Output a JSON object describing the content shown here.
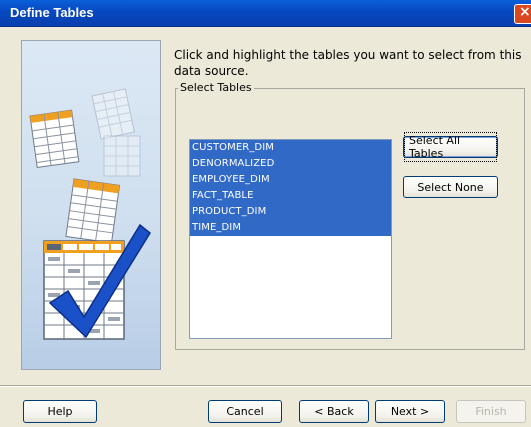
{
  "window": {
    "title": "Define Tables",
    "close_symbol": "×"
  },
  "instruction": "Click and highlight the tables you want to select from this data source.",
  "select_tables": {
    "legend": "Select Tables",
    "items": [
      "CUSTOMER_DIM",
      "DENORMALIZED",
      "EMPLOYEE_DIM",
      "FACT_TABLE",
      "PRODUCT_DIM",
      "TIME_DIM"
    ],
    "select_all_label": "Select All Tables",
    "select_none_label": "Select None"
  },
  "footer": {
    "help_label": "Help",
    "cancel_label": "Cancel",
    "back_label": "< Back",
    "next_label": "Next >",
    "finish_label": "Finish"
  },
  "colors": {
    "title_bar": "#0848c0",
    "selection": "#3169c6",
    "checkmark": "#1a50c8",
    "table_header": "#f0a020"
  },
  "icons": {
    "illustration": "tables-with-checkmark-illustration"
  }
}
